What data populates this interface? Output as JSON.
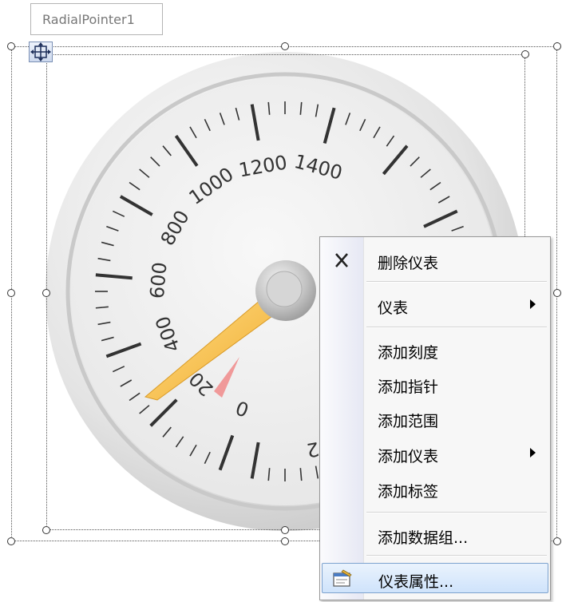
{
  "component": {
    "name": "RadialPointer1"
  },
  "gauge": {
    "scale_labels": [
      "0",
      "200",
      "400",
      "600",
      "800",
      "1000",
      "1200",
      "1400",
      "2"
    ],
    "colors": {
      "pointer": "#f7c24a",
      "range": "#f08080",
      "face": "#eeeeee"
    }
  },
  "context_menu": {
    "delete_gauge": "删除仪表",
    "gauge": "仪表",
    "add_scale": "添加刻度",
    "add_pointer": "添加指针",
    "add_range": "添加范围",
    "add_gauge": "添加仪表",
    "add_label": "添加标签",
    "add_data_group": "添加数据组...",
    "gauge_properties": "仪表属性...",
    "icons": {
      "delete": "close-x-icon",
      "properties": "properties-icon"
    }
  }
}
